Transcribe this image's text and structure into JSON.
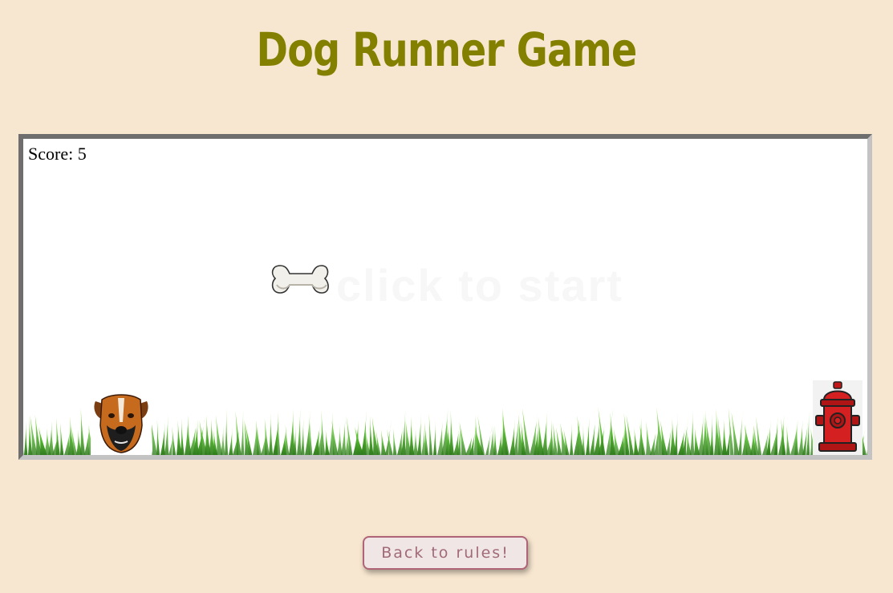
{
  "title": "Dog Runner Game",
  "game": {
    "score_text": "Score: 5",
    "score": 5,
    "watermark_text": "click to start"
  },
  "buttons": {
    "back_label": "Back to rules!"
  },
  "colors": {
    "background": "#f8e7d0",
    "title": "#838000",
    "board": "#ffffff",
    "button_border": "#b06478"
  },
  "icons": [
    "dog-icon",
    "bone-icon",
    "fire-hydrant-icon",
    "grass-icon"
  ]
}
